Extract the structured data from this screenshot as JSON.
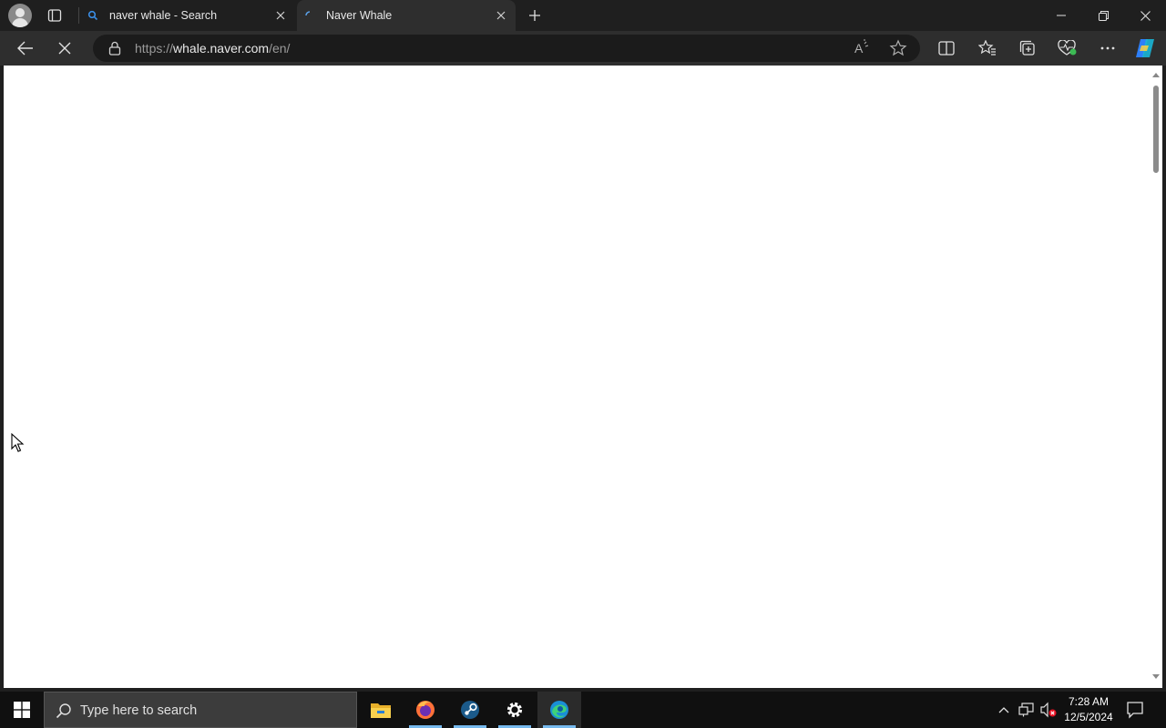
{
  "browser": {
    "tabs": [
      {
        "title": "naver whale - Search",
        "favicon": "search-icon",
        "active": false
      },
      {
        "title": "Naver Whale",
        "favicon": "loading-spinner-icon",
        "active": true
      }
    ],
    "address": {
      "scheme": "https://",
      "host": "whale.naver.com",
      "path": "/en/"
    },
    "loading": true
  },
  "taskbar": {
    "search_placeholder": "Type here to search",
    "apps": [
      "file-explorer-icon",
      "firefox-icon",
      "steam-icon",
      "settings-icon",
      "edge-icon"
    ],
    "clock": {
      "time": "7:28 AM",
      "date": "12/5/2024"
    }
  },
  "colors": {
    "titlebar": "#1f1f1f",
    "toolbar": "#2e2e2e",
    "omnibox": "#1b1b1b",
    "taskbar": "#101010",
    "accent": "#76b9ed"
  }
}
